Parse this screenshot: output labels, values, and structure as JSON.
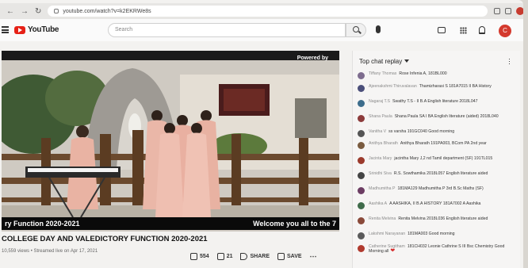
{
  "browser": {
    "url": "youtube.com/watch?v=k2EKRWe8s"
  },
  "header": {
    "logo_text": "YouTube",
    "search_placeholder": "Search",
    "avatar_initial": "C"
  },
  "player": {
    "watermark": "Powered by",
    "caption_left": "ry Function 2020-2021",
    "caption_right": "Welcome you all to the 7"
  },
  "video": {
    "title": "COLLEGE DAY AND VALEDICTORY FUNCTION 2020-2021",
    "meta": "10,559 views • Streamed live on Apr 17, 2021",
    "likes": "554",
    "dislikes": "21",
    "share_label": "SHARE",
    "save_label": "SAVE"
  },
  "chat": {
    "header": "Top chat replay",
    "messages": [
      {
        "name": "Tiffany Thomas",
        "text": "Rose Infenia A, 181BL000",
        "color": "#7d6c8e"
      },
      {
        "name": "Ajeenakshmi Thiruvalavan",
        "text": "Thamizharasi S 181A7015 II BA History",
        "color": "#4b4f7a"
      },
      {
        "name": "Nagaraj T.S",
        "text": "Swathy T.S - II B.A English literature 2018L047",
        "color": "#3d6d8c"
      },
      {
        "name": "Shana Paula",
        "text": "Shana Paula SA I BA English literature (aided) 2018L040",
        "color": "#8c3b3b"
      },
      {
        "name": "Vanitha V",
        "text": "ss varsha 191GC040 Good morning",
        "color": "#555"
      },
      {
        "name": "Anithya Bharath",
        "text": "Anithya Bharath 191PA003, BCom PA 2nd year",
        "color": "#7a5b3f"
      },
      {
        "name": "Jacinta Mary",
        "text": "jacintha Mary J,2 nd Tamil department (SF) 191TL015",
        "color": "#9b3a2c"
      },
      {
        "name": "Srinidhi Siva",
        "text": "R.S. Sowthamika 2018L057 English literature aided",
        "color": "#444"
      },
      {
        "name": "Madhumitha P",
        "text": "181MA129 Madhumitha P 3rd B.Sc Maths (SF)",
        "color": "#6c3d63"
      },
      {
        "name": "Aashika A",
        "text": "A AASHIKA, II B.A HISTORY 181A7002 A Aashika",
        "color": "#3f6b4a"
      },
      {
        "name": "Renita Melvina",
        "text": "Renita Melvina 2018L036 English literature aided",
        "color": "#8a4a3a"
      },
      {
        "name": "Lakshmi Narayanan",
        "text": "181MA003 Good morning",
        "color": "#5a5a5a"
      },
      {
        "name": "Catherine Sugitham",
        "text": "181CH032 Leonie Cathrine S III Bsc Chemistry Good Morning all",
        "color": "#b03a2e"
      }
    ]
  },
  "colors": {
    "accent": "#e62117",
    "avatar": "#d43a2e"
  }
}
